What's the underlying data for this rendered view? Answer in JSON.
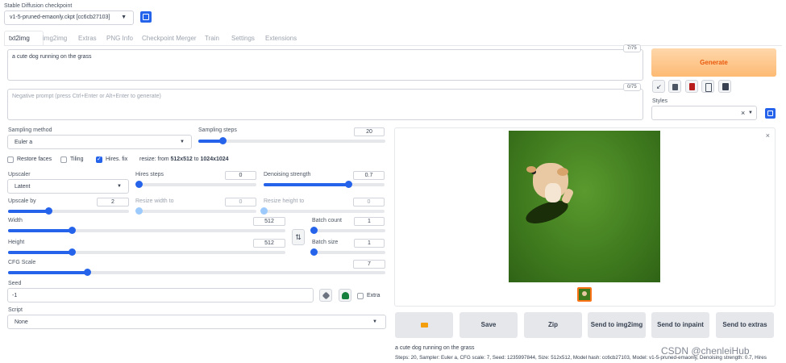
{
  "checkpoint": {
    "label": "Stable Diffusion checkpoint",
    "value": "v1-5-pruned-emaonly.ckpt [cc6cb27103]"
  },
  "tabs": [
    "txt2img",
    "img2img",
    "Extras",
    "PNG Info",
    "Checkpoint Merger",
    "Train",
    "Settings",
    "Extensions"
  ],
  "prompt": {
    "value": "a cute dog running on the grass",
    "counter": "7/75"
  },
  "negative_prompt": {
    "placeholder": "Negative prompt (press Ctrl+Enter or Alt+Enter to generate)",
    "counter": "0/75"
  },
  "generate_label": "Generate",
  "styles_label": "Styles",
  "styles_clear": "×",
  "sampling": {
    "method_label": "Sampling method",
    "method_value": "Euler a",
    "steps_label": "Sampling steps",
    "steps_value": "20",
    "steps_fraction": 0.13
  },
  "options": {
    "restore_faces": "Restore faces",
    "tiling": "Tiling",
    "hires_fix": "Hires. fix",
    "resize_prefix": "resize: from ",
    "resize_from": "512x512",
    "resize_to_word": " to ",
    "resize_to": "1024x1024"
  },
  "upscaler": {
    "label": "Upscaler",
    "value": "Latent"
  },
  "hires_steps": {
    "label": "Hires steps",
    "value": "0",
    "fraction": 0.0
  },
  "denoising": {
    "label": "Denoising strength",
    "value": "0.7",
    "fraction": 0.7
  },
  "upscale_by": {
    "label": "Upscale by",
    "value": "2",
    "fraction": 0.33
  },
  "resize_width": {
    "label": "Resize width to",
    "value": "0"
  },
  "resize_height": {
    "label": "Resize height to",
    "value": "0"
  },
  "width": {
    "label": "Width",
    "value": "512",
    "fraction": 0.23
  },
  "height": {
    "label": "Height",
    "value": "512",
    "fraction": 0.23
  },
  "swap_icon": "⇅",
  "batch_count": {
    "label": "Batch count",
    "value": "1",
    "fraction": 0.0
  },
  "batch_size": {
    "label": "Batch size",
    "value": "1",
    "fraction": 0.0
  },
  "cfg": {
    "label": "CFG Scale",
    "value": "7",
    "fraction": 0.21
  },
  "seed": {
    "label": "Seed",
    "value": "-1",
    "extra": "Extra"
  },
  "script": {
    "label": "Script",
    "value": "None"
  },
  "output": {
    "buttons": [
      "Save",
      "Zip",
      "Send to img2img",
      "Send to inpaint",
      "Send to extras"
    ],
    "caption": "a cute dog running on the grass",
    "info": "Steps: 20, Sampler: Euler a, CFG scale: 7, Seed: 1235997844, Size: 512x512, Model hash: cc6cb27103, Model: v1-5-pruned-emaonly, Denoising strength: 0.7, Hires",
    "close": "×"
  },
  "watermark": "CSDN @chenleiHub",
  "colors": {
    "accent": "#2563eb",
    "generate": "#fb923c",
    "grass": "#3f7a1e"
  }
}
